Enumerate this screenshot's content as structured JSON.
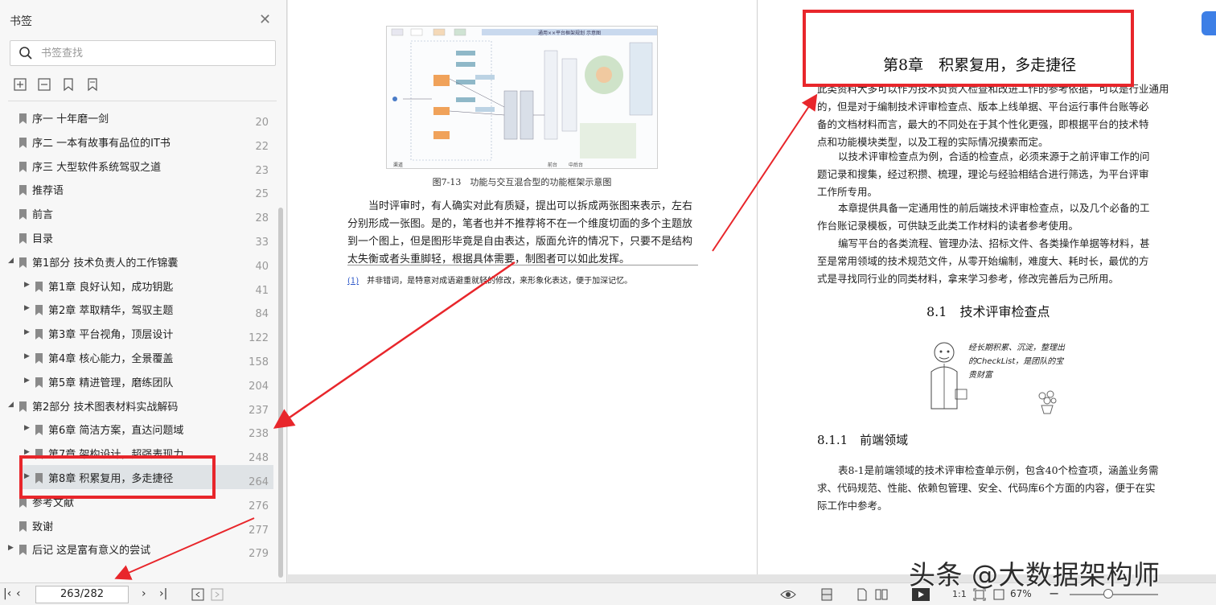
{
  "sidebar": {
    "title": "书签",
    "search_placeholder": "书签查找",
    "items": [
      {
        "label": "序一 十年磨一剑",
        "page": "20",
        "level": 0,
        "expander": false
      },
      {
        "label": "序二 一本有故事有品位的IT书",
        "page": "22",
        "level": 0,
        "expander": false
      },
      {
        "label": "序三 大型软件系统驾驭之道",
        "page": "23",
        "level": 0,
        "expander": false
      },
      {
        "label": "推荐语",
        "page": "25",
        "level": 0,
        "expander": false
      },
      {
        "label": "前言",
        "page": "28",
        "level": 0,
        "expander": false
      },
      {
        "label": "目录",
        "page": "33",
        "level": 0,
        "expander": false
      },
      {
        "label": "第1部分 技术负责人的工作锦囊",
        "page": "40",
        "level": 0,
        "expander": "open"
      },
      {
        "label": "第1章 良好认知，成功钥匙",
        "page": "41",
        "level": 1,
        "expander": "closed"
      },
      {
        "label": "第2章 萃取精华，驾驭主题",
        "page": "84",
        "level": 1,
        "expander": "closed"
      },
      {
        "label": "第3章 平台视角，顶层设计",
        "page": "122",
        "level": 1,
        "expander": "closed"
      },
      {
        "label": "第4章 核心能力，全景覆盖",
        "page": "158",
        "level": 1,
        "expander": "closed"
      },
      {
        "label": "第5章 精进管理，磨练团队",
        "page": "204",
        "level": 1,
        "expander": "closed"
      },
      {
        "label": "第2部分 技术图表材料实战解码",
        "page": "237",
        "level": 0,
        "expander": "open"
      },
      {
        "label": "第6章 简洁方案，直达问题域",
        "page": "238",
        "level": 1,
        "expander": "closed"
      },
      {
        "label": "第7章 架构设计，超强表现力",
        "page": "248",
        "level": 1,
        "expander": "closed"
      },
      {
        "label": "第8章 积累复用，多走捷径",
        "page": "264",
        "level": 1,
        "expander": "closed",
        "selected": true
      },
      {
        "label": "参考文献",
        "page": "276",
        "level": 0,
        "expander": false
      },
      {
        "label": "致谢",
        "page": "277",
        "level": 0,
        "expander": false
      },
      {
        "label": "后记 这是富有意义的尝试",
        "page": "279",
        "level": 0,
        "expander": "closed"
      }
    ]
  },
  "left_page": {
    "figure_title": "通用××平台框架规划 示意图",
    "figure_bottom_labels": [
      "渠道",
      "前台",
      "中后台"
    ],
    "caption": "图7-13　功能与交互混合型的功能框架示意图",
    "body": [
      "当时评审时，有人确实对此有质疑，提出可以拆成两张图来表示，左右",
      "分别形成一张图。是的，笔者也并不推荐将不在一个维度切面的多个主题放",
      "到一个图上，但是图形毕竟是自由表达，版面允许的情况下，只要不是结构",
      "太失衡或者头重脚轻，根据具体需要，制图者可以如此发挥。"
    ],
    "footnote_ref": "(1)",
    "footnote": "并非错词，是特意对成语避重就轻的修改，来形象化表达，便于加深记忆。"
  },
  "right_page": {
    "chapter_title": "第8章　积累复用，多走捷径",
    "intro": [
      "此类资料大多可以作为技术负责人检查和改进工作的参考依据，可以是行业通用",
      "的，但是对于编制技术评审检查点、版本上线单据、平台运行事件台账等必",
      "备的文档材料而言，最大的不同处在于其个性化更强，即根据平台的技术特",
      "点和功能模块类型，以及工程的实际情况摸索而定。"
    ],
    "para2": [
      "以技术评审检查点为例，合适的检查点，必须来源于之前评审工作的问",
      "题记录和搜集，经过积攒、梳理，理论与经验相结合进行筛选，为平台评审",
      "工作所专用。"
    ],
    "para3": [
      "本章提供具备一定通用性的前后端技术评审检查点，以及几个必备的工",
      "作台账记录模板，可供缺乏此类工作材料的读者参考使用。"
    ],
    "para4": [
      "编写平台的各类流程、管理办法、招标文件、各类操作单据等材料，甚",
      "至是常用领域的技术规范文件，从零开始编制，难度大、耗时长，最优的方",
      "式是寻找同行业的同类材料，拿来学习参考，修改完善后为己所用。"
    ],
    "section_title": "8.1　技术评审检查点",
    "illustration_text": "经长期积累、沉淀，整理出的CheckList，是团队的宝贵财富",
    "subsection_title": "8.1.1　前端领域",
    "para5": [
      "表8-1是前端领域的技术评审检查单示例，包含40个检查项，涵盖业务需",
      "求、代码规范、性能、依赖包管理、安全、代码库6个方面的内容，便于在实",
      "际工作中参考。"
    ]
  },
  "toolbar": {
    "page_indicator": "263/282",
    "zoom": "67%"
  },
  "watermark": "头条 @大数据架构师",
  "colors": {
    "annotation_red": "#e8262b",
    "selected_row": "#dfe3e6",
    "link_blue": "#2a55c8"
  }
}
